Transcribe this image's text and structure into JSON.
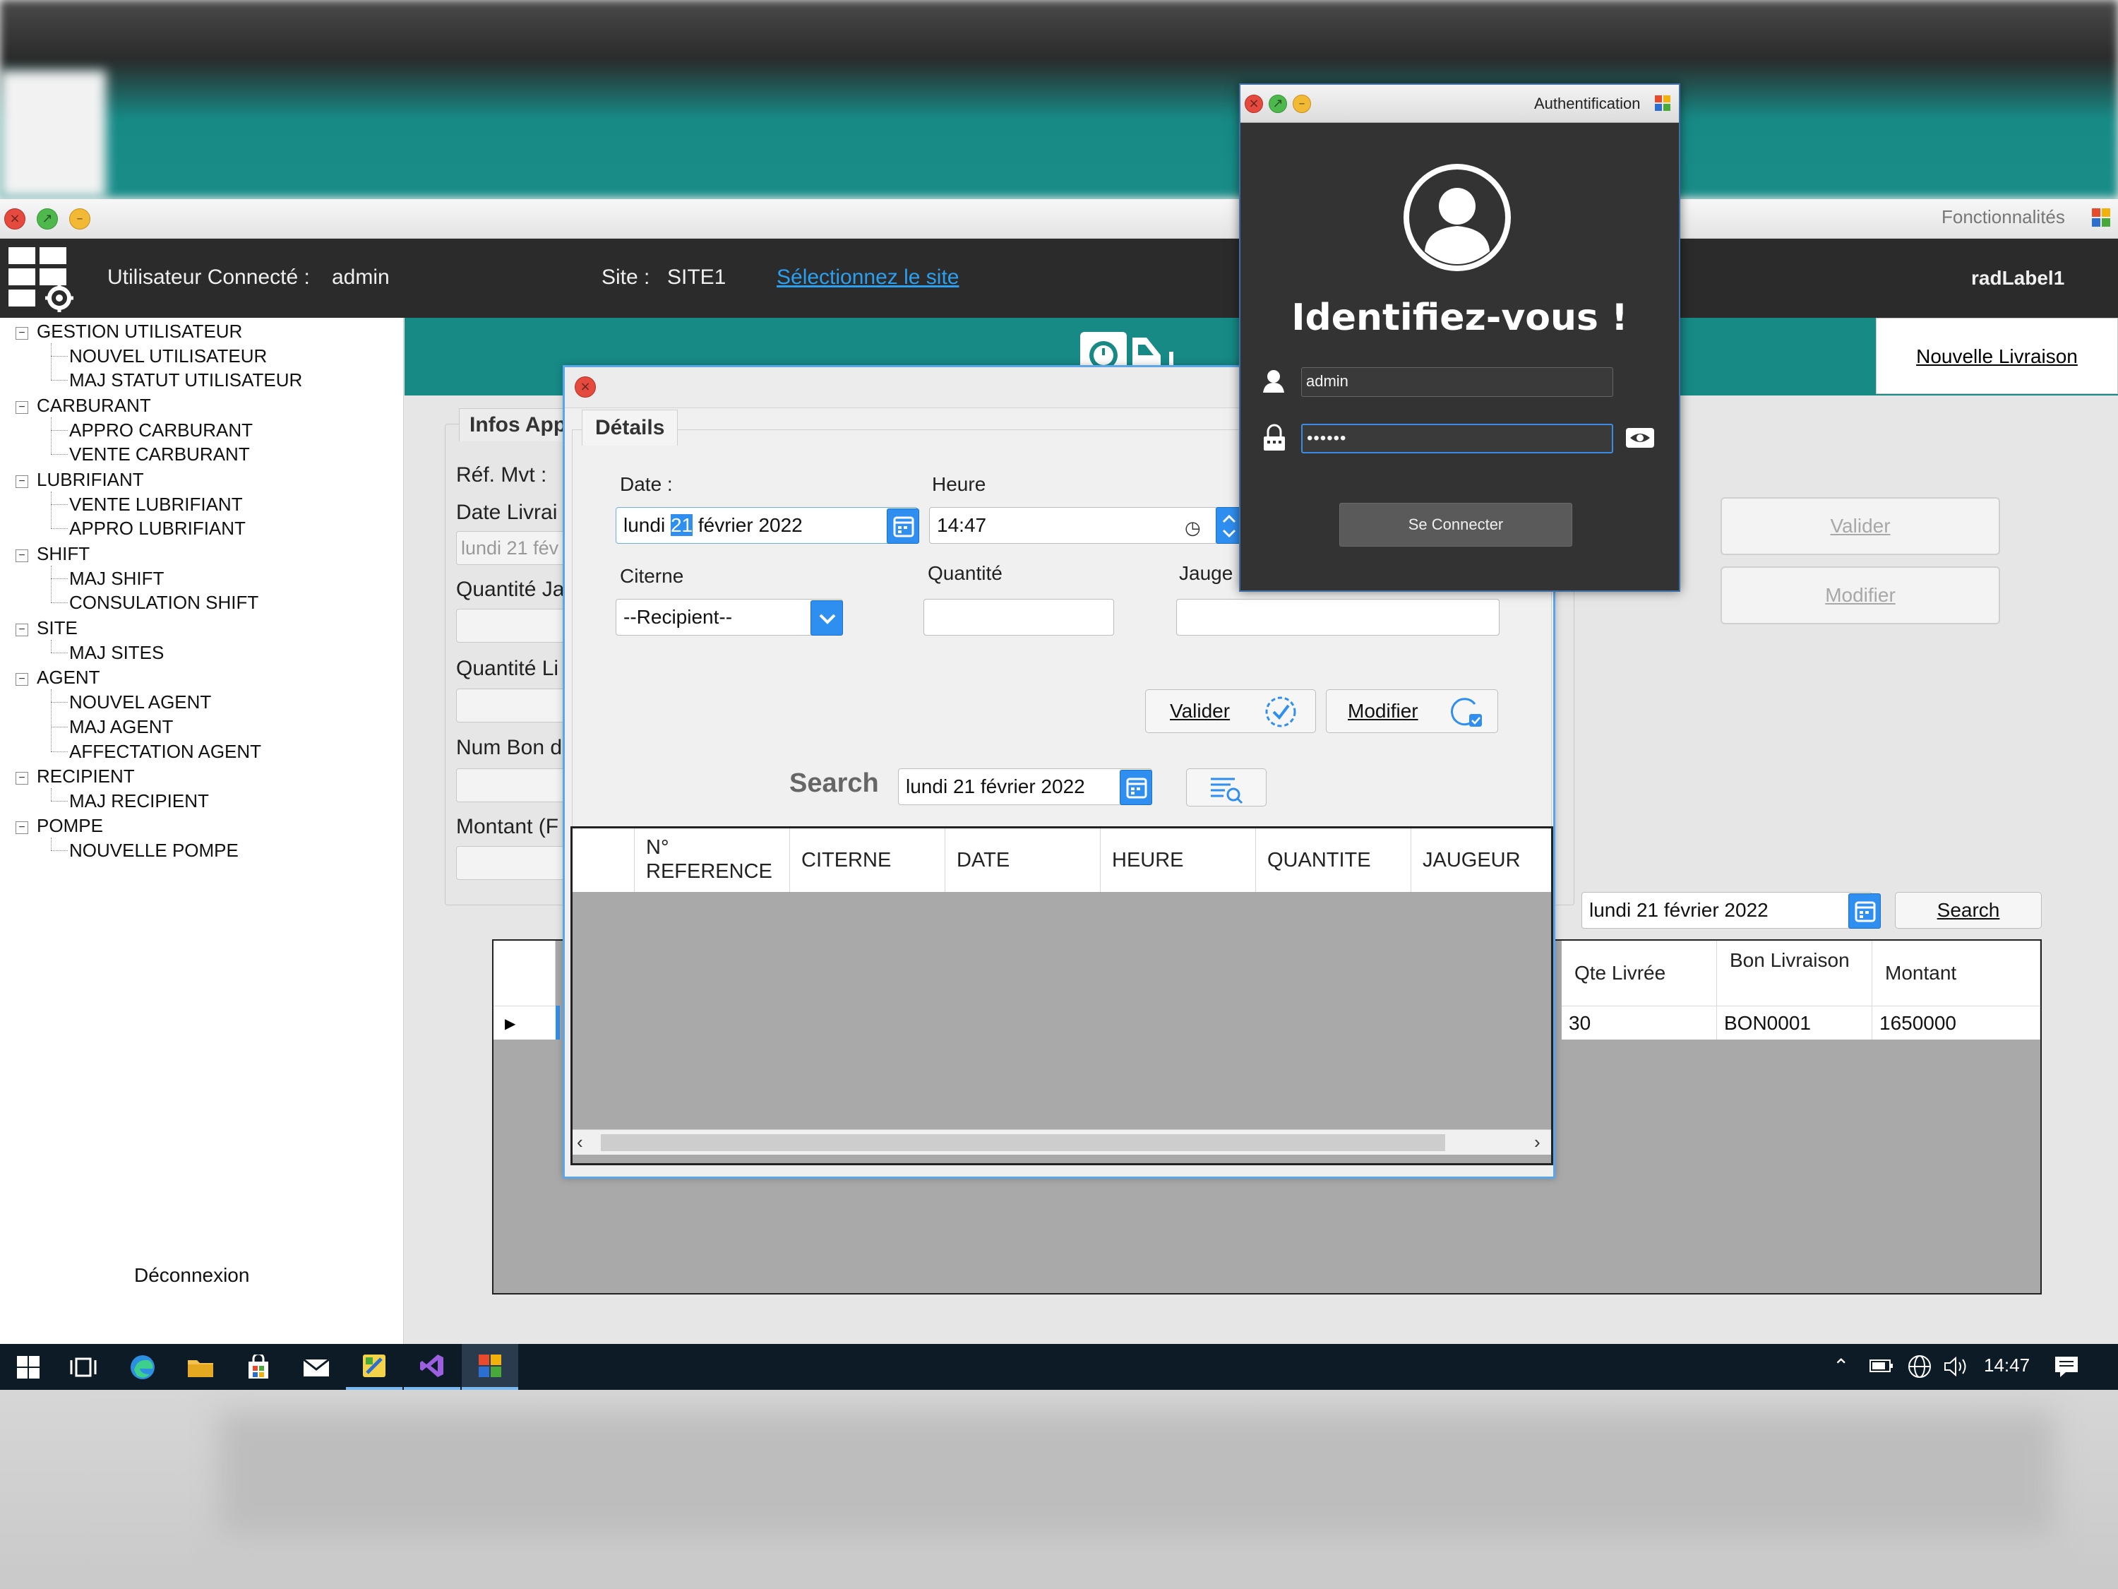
{
  "main_window": {
    "menu_label": "Fonctionnalités",
    "header": {
      "user_label": "Utilisateur Connecté :",
      "user_value": "admin",
      "site_label": "Site :",
      "site_value": "SITE1",
      "select_site_link": "Sélectionnez le site",
      "rad_label": "radLabel1"
    },
    "sidebar": {
      "tree": [
        {
          "label": "GESTION UTILISATEUR",
          "children": [
            "NOUVEL UTILISATEUR",
            "MAJ STATUT UTILISATEUR"
          ]
        },
        {
          "label": "CARBURANT",
          "children": [
            "APPRO CARBURANT",
            "VENTE CARBURANT"
          ]
        },
        {
          "label": "LUBRIFIANT",
          "children": [
            "VENTE LUBRIFIANT",
            "APPRO LUBRIFIANT"
          ]
        },
        {
          "label": "SHIFT",
          "children": [
            "MAJ SHIFT",
            "CONSULATION SHIFT"
          ]
        },
        {
          "label": "SITE",
          "children": [
            "MAJ SITES"
          ]
        },
        {
          "label": "AGENT",
          "children": [
            "NOUVEL AGENT",
            "MAJ AGENT",
            "AFFECTATION AGENT"
          ]
        },
        {
          "label": "RECIPIENT",
          "children": [
            "MAJ RECIPIENT"
          ]
        },
        {
          "label": "POMPE",
          "children": [
            "NOUVELLE POMPE"
          ]
        }
      ],
      "logout": "Déconnexion"
    },
    "nouvelle_livraison": "Nouvelle Livraison",
    "infos": {
      "tab": "Infos App",
      "ref_mvt": "Réf. Mvt :",
      "date_livraison": "Date Livrai",
      "date_value": "lundi 21 fév",
      "quantite_ja": "Quantité Ja",
      "quantite_li": "Quantité Li",
      "num_bon": "Num Bon d",
      "montant": "Montant (F"
    },
    "buttons": {
      "valider": "Valider",
      "modifier": "Modifier",
      "search": "Search"
    },
    "search_date": "lundi 21 février 2022",
    "grid": {
      "columns": [
        "Qte Livrée",
        "Bon Livraison",
        "Montant"
      ],
      "rows": [
        [
          "30",
          "BON0001",
          "1650000"
        ]
      ]
    }
  },
  "details_dialog": {
    "tab": "Détails",
    "date_label": "Date :",
    "date_value": "lundi 21 février 2022",
    "date_day_selected": "21",
    "heure_label": "Heure",
    "heure_value": "14:47",
    "citerne_label": "Citerne",
    "citerne_value": "--Recipient--",
    "quantite_label": "Quantité",
    "jauge_label": "Jauge",
    "valider": "Valider",
    "modifier": "Modifier",
    "search_label": "Search",
    "search_date": "lundi 21 février 2022",
    "grid_columns": [
      "N° REFERENCE",
      "CITERNE",
      "DATE",
      "HEURE",
      "QUANTITE",
      "JAUGEUR"
    ]
  },
  "auth_dialog": {
    "title": "Authentification",
    "heading": "Identifiez-vous !",
    "username": "admin",
    "password_mask": "••••••",
    "connect": "Se Connecter"
  },
  "taskbar": {
    "time": "14:47"
  },
  "colors": {
    "teal": "#178a86",
    "header_dark": "#2b2b2b",
    "link_blue": "#2b9ff0",
    "accent_blue": "#2f8ff0"
  }
}
